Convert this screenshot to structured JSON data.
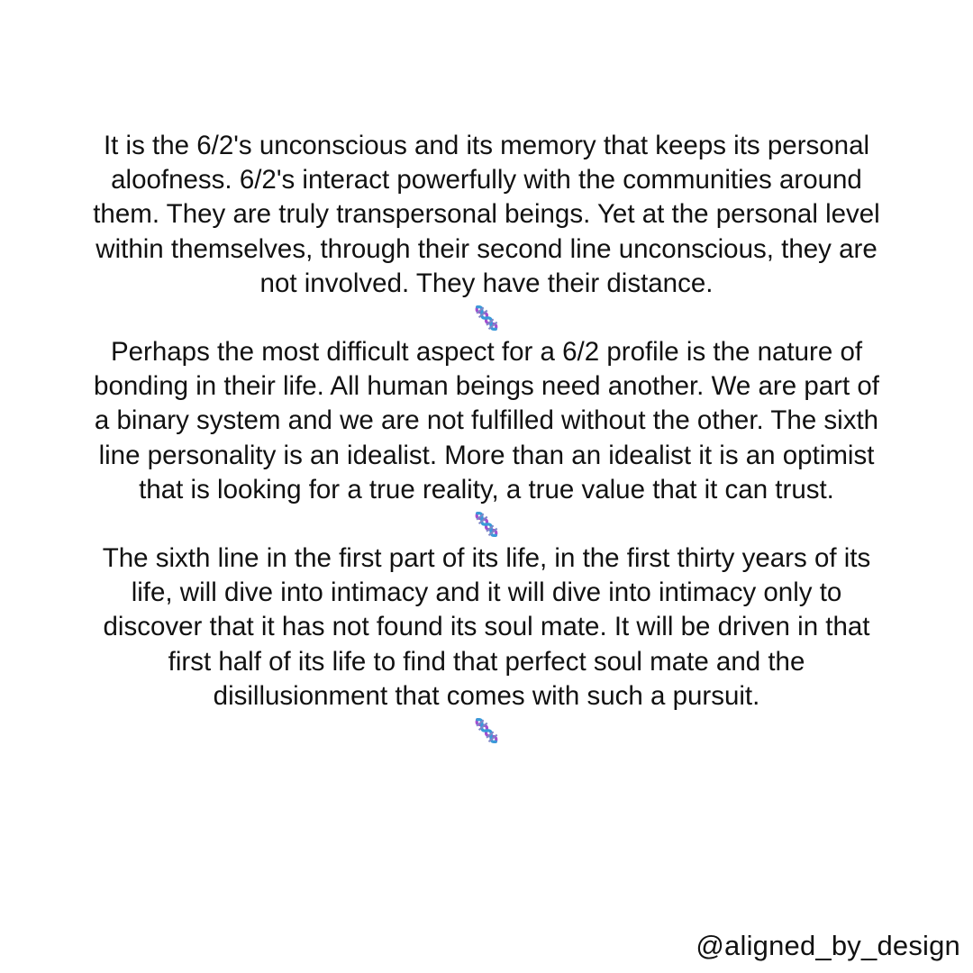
{
  "post": {
    "paragraphs": [
      "It is the 6/2's unconscious and its memory that keeps its personal aloofness. 6/2's interact powerfully with the communities around them. They are truly transpersonal beings. Yet at the personal level within themselves, through their second line unconscious, they are not involved. They have their distance.",
      "Perhaps the most difficult aspect for a 6/2 profile is the nature of bonding in their life. All human beings need another. We are part of a binary system and we are not fulfilled without the other. The sixth line personality is an idealist. More than an idealist it is an optimist that is looking for a true reality, a true value that it can trust.",
      "The sixth line in the first part of its life, in the first thirty years of its life, will dive into intimacy and it will dive into intimacy only to discover that it has not found its soul mate. It will be driven in that first half of its life to find that perfect soul mate and the disillusionment that comes with such a pursuit."
    ],
    "divider_icon": "dna-icon"
  },
  "handle": "@aligned_by_design",
  "colors": {
    "background": "#ffffff",
    "text": "#111111",
    "dna_purple": "#a24fcf",
    "dna_blue": "#3a9ad9"
  }
}
